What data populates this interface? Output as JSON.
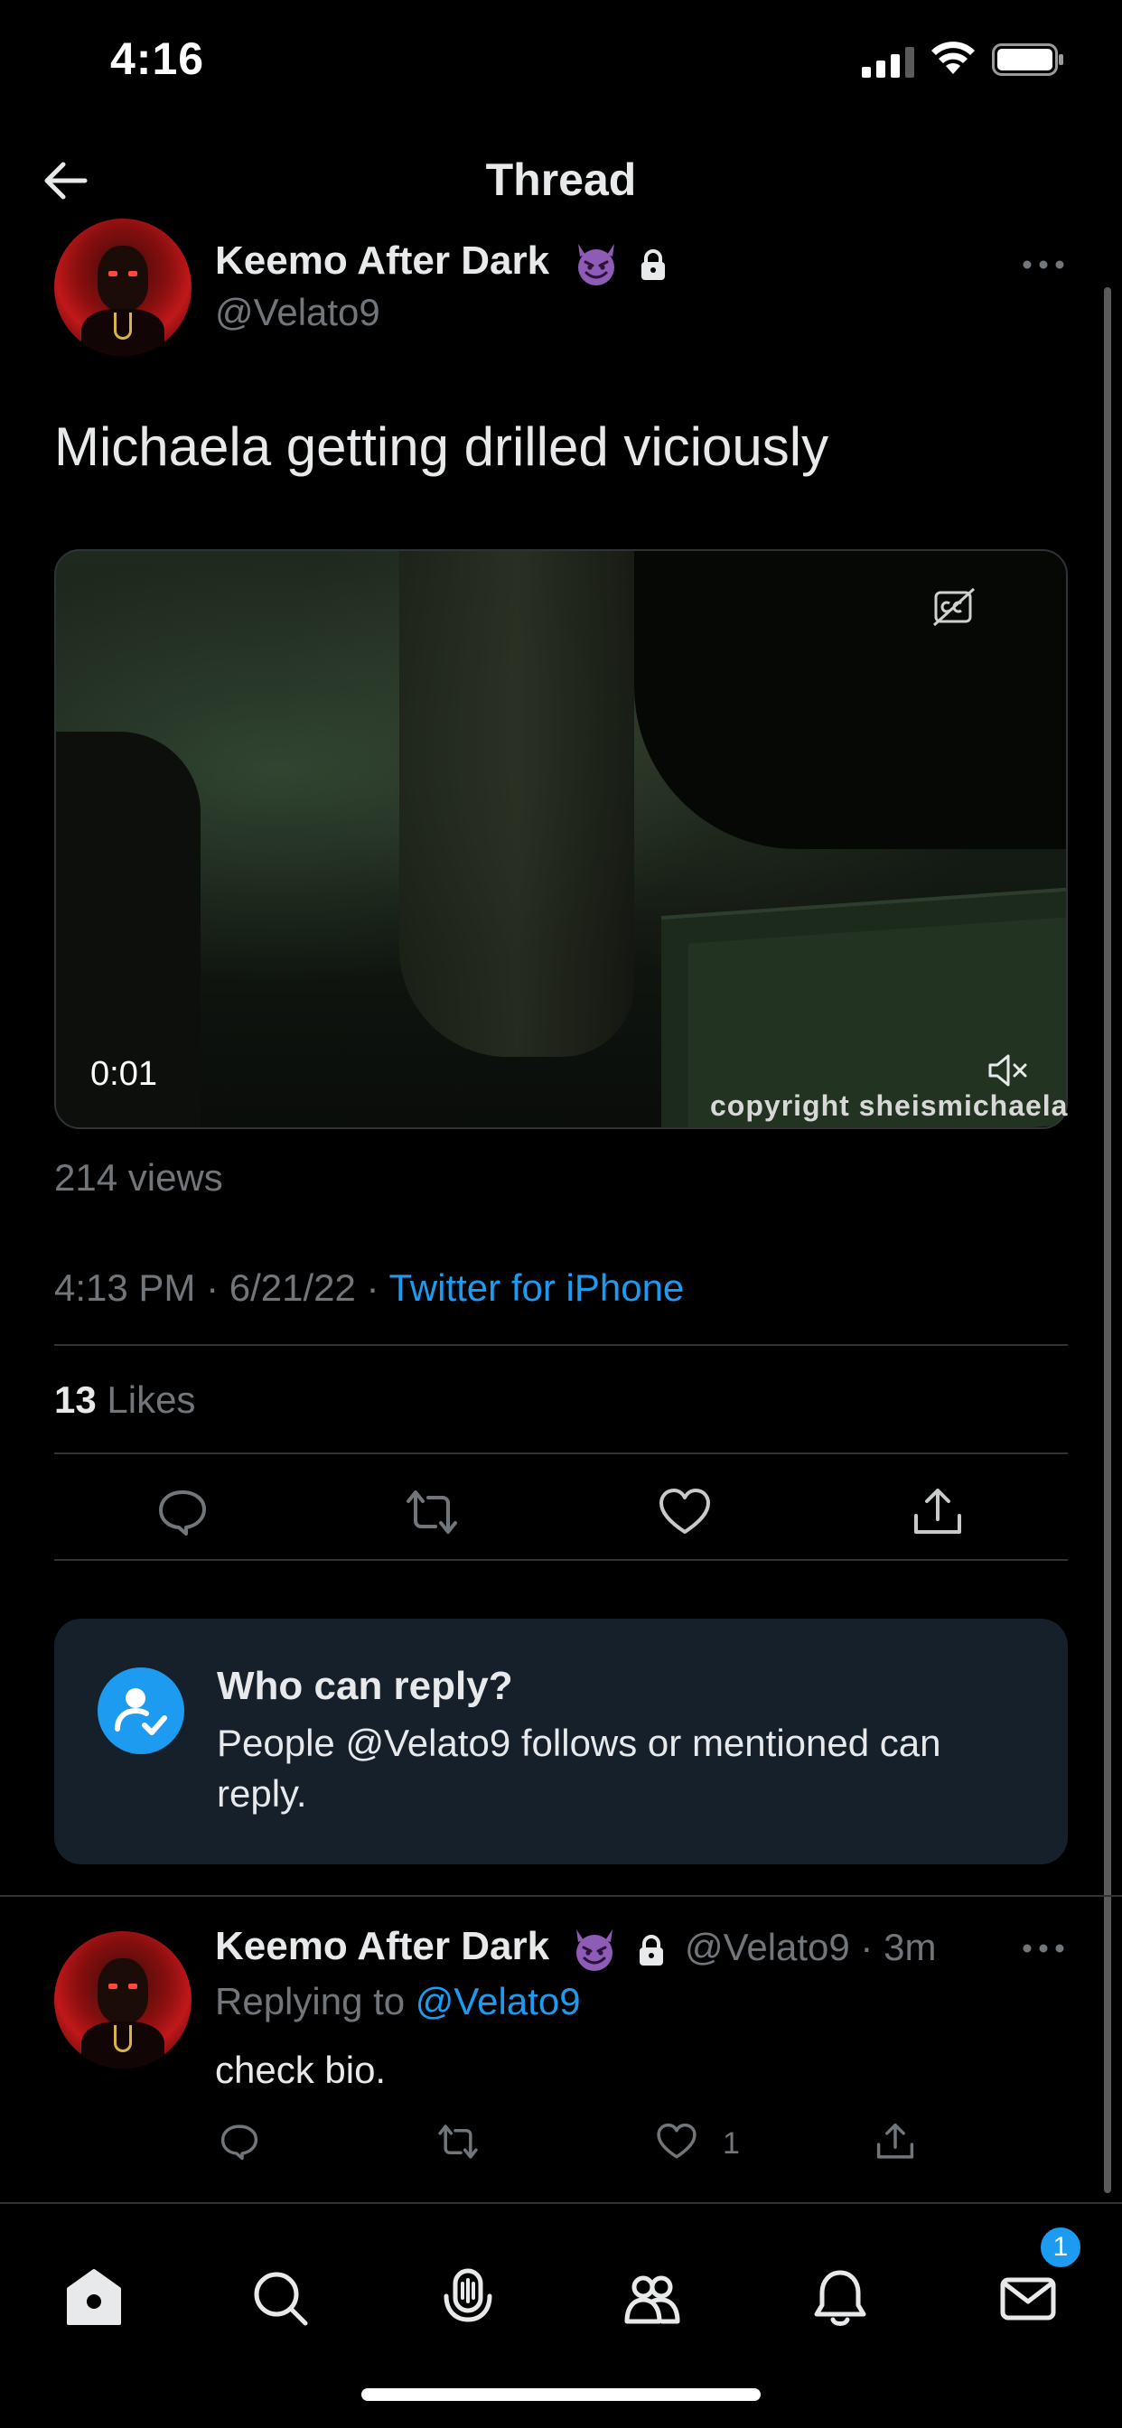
{
  "status_bar": {
    "time": "4:16"
  },
  "header": {
    "title": "Thread"
  },
  "tweet": {
    "author_name": "Keemo After Dark",
    "author_handle": "@Velato9",
    "text": "Michaela getting drilled viciously",
    "video": {
      "duration": "0:01",
      "watermark": "copyright  sheismichaela"
    },
    "views": "214 views",
    "time": "4:13 PM",
    "date": "6/21/22",
    "source": "Twitter for iPhone",
    "separator": " · ",
    "likes_count": "13",
    "likes_label": " Likes"
  },
  "who_can_reply": {
    "title": "Who can reply?",
    "body": "People @Velato9 follows or mentioned can reply."
  },
  "reply": {
    "author_name": "Keemo After Dark",
    "handle_time": "@Velato9 · 3m",
    "replying_prefix": "Replying to ",
    "replying_mention": "@Velato9",
    "text": "check bio.",
    "like_count": "1"
  },
  "tab_bar": {
    "items": [
      "home-icon",
      "search-icon",
      "spaces-icon",
      "communities-icon",
      "notifications-icon",
      "messages-icon"
    ],
    "messages_badge": "1"
  },
  "colors": {
    "background": "#000000",
    "accent": "#1d9bf0",
    "muted_text": "#71767b",
    "primary_text": "#e7e9ea",
    "card_bg": "#15202b"
  }
}
